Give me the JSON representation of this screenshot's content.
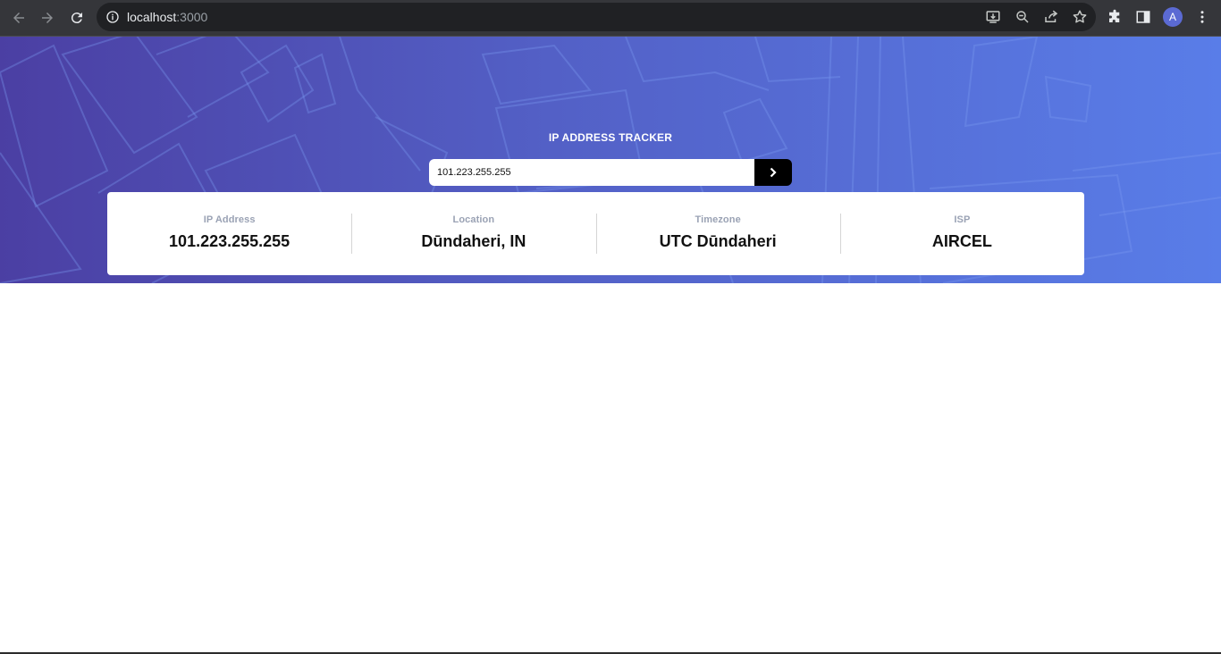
{
  "browser": {
    "url_host": "localhost",
    "url_port": ":3000",
    "profile_initial": "A"
  },
  "app": {
    "title": "IP ADDRESS TRACKER",
    "search": {
      "value": "101.223.255.255"
    },
    "info": [
      {
        "label": "IP Address",
        "value": "101.223.255.255"
      },
      {
        "label": "Location",
        "value": "Dūndaheri, IN"
      },
      {
        "label": "Timezone",
        "value": "UTC Dūndaheri"
      },
      {
        "label": "ISP",
        "value": "AIRCEL"
      }
    ]
  },
  "colors": {
    "hero_gradient_start": "#4b3fa3",
    "hero_gradient_end": "#597de8",
    "button": "#000000",
    "label": "#9aa2b4"
  }
}
